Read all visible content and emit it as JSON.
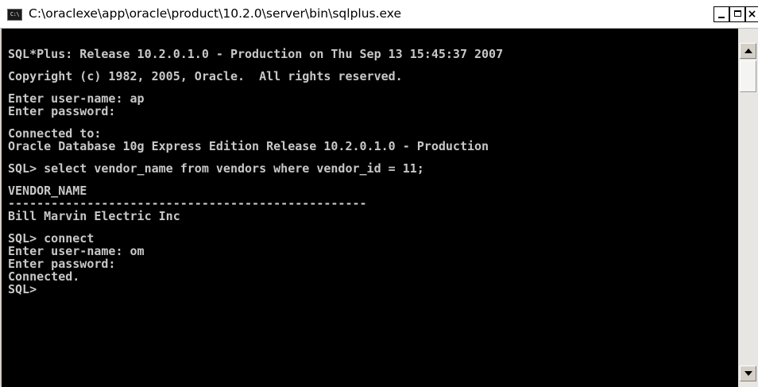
{
  "window": {
    "title": "C:\\oraclexe\\app\\oracle\\product\\10.2.0\\server\\bin\\sqlplus.exe",
    "icon_label": "C:\\",
    "icon": "console-icon",
    "buttons": {
      "minimize": "minimize-icon",
      "maximize": "maximize-icon",
      "close": "close-icon",
      "close_label": "×"
    }
  },
  "console": {
    "lines": [
      "SQL*Plus: Release 10.2.0.1.0 - Production on Thu Sep 13 15:45:37 2007",
      "",
      "Copyright (c) 1982, 2005, Oracle.  All rights reserved.",
      "",
      "Enter user-name: ap",
      "Enter password:",
      "",
      "Connected to:",
      "Oracle Database 10g Express Edition Release 10.2.0.1.0 - Production",
      "",
      "SQL> select vendor_name from vendors where vendor_id = 11;",
      "",
      "VENDOR_NAME",
      "--------------------------------------------------",
      "Bill Marvin Electric Inc",
      "",
      "SQL> connect",
      "Enter user-name: om",
      "Enter password:",
      "Connected.",
      "SQL>"
    ],
    "text_color": "#c8c8c8",
    "background": "#000000"
  },
  "scrollbar": {
    "up": "scroll-up-icon",
    "down": "scroll-down-icon"
  }
}
